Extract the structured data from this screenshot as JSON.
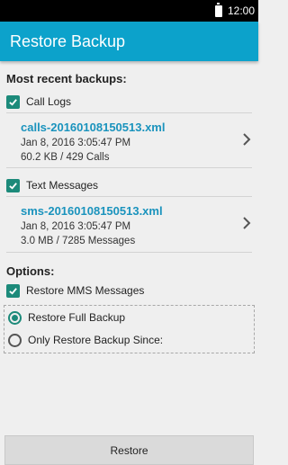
{
  "status_bar": {
    "time": "12:00"
  },
  "app_bar": {
    "title": "Restore Backup"
  },
  "recent": {
    "heading": "Most recent backups:",
    "call_logs": {
      "checkbox_label": "Call Logs",
      "checked": true,
      "file_name": "calls-20160108150513.xml",
      "date": "Jan 8, 2016 3:05:47 PM",
      "size": "60.2 KB / 429 Calls"
    },
    "text_messages": {
      "checkbox_label": "Text Messages",
      "checked": true,
      "file_name": "sms-20160108150513.xml",
      "date": "Jan 8, 2016 3:05:47 PM",
      "size": "3.0 MB / 7285 Messages"
    }
  },
  "options": {
    "heading": "Options:",
    "restore_mms": {
      "label": "Restore MMS Messages",
      "checked": true
    },
    "radios": [
      {
        "label": "Restore Full Backup",
        "selected": true
      },
      {
        "label": "Only Restore Backup Since:",
        "selected": false
      }
    ]
  },
  "footer": {
    "restore_label": "Restore"
  },
  "colors": {
    "accent": "#0ca2cb",
    "checkbox": "#1c8a7a",
    "link": "#1a93bd"
  },
  "icons": {
    "battery": "battery-icon",
    "check": "check-icon",
    "chevron": "chevron-right-icon"
  }
}
